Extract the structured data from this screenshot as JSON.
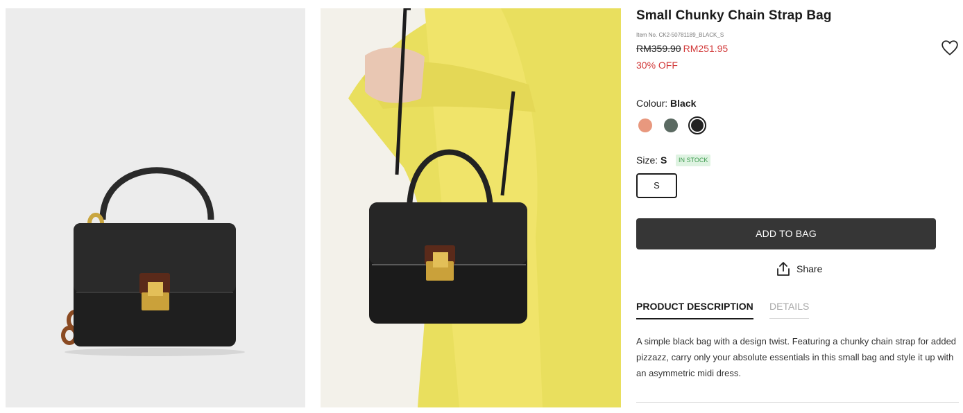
{
  "product": {
    "title": "Small Chunky Chain Strap Bag",
    "item_no": "Item No. CK2-50781189_BLACK_S",
    "price_original": "RM359.90",
    "price_sale": "RM251.95",
    "discount": "30% OFF"
  },
  "colour": {
    "label": "Colour:",
    "selected": "Black",
    "options": [
      {
        "name": "Coral",
        "hex": "#e8987e"
      },
      {
        "name": "Sage",
        "hex": "#5b6a62"
      },
      {
        "name": "Black",
        "hex": "#222222"
      }
    ]
  },
  "size": {
    "label": "Size:",
    "selected": "S",
    "stock_status": "IN STOCK",
    "options": [
      "S"
    ]
  },
  "actions": {
    "add_to_bag": "ADD TO BAG",
    "share": "Share"
  },
  "tabs": {
    "product_description": "PRODUCT DESCRIPTION",
    "details": "DETAILS"
  },
  "description": "A simple black bag with a design twist. Featuring a chunky chain strap for added pizzazz, carry only your absolute essentials in this small bag and style it up with an asymmetric midi dress.",
  "icons": {
    "wishlist": "heart-icon",
    "share": "share-upload-icon"
  },
  "colors": {
    "sale_price": "#d23a3a",
    "button_bg": "#363636",
    "stock_badge_bg": "#dff3e2",
    "stock_badge_text": "#3b9a4d"
  }
}
